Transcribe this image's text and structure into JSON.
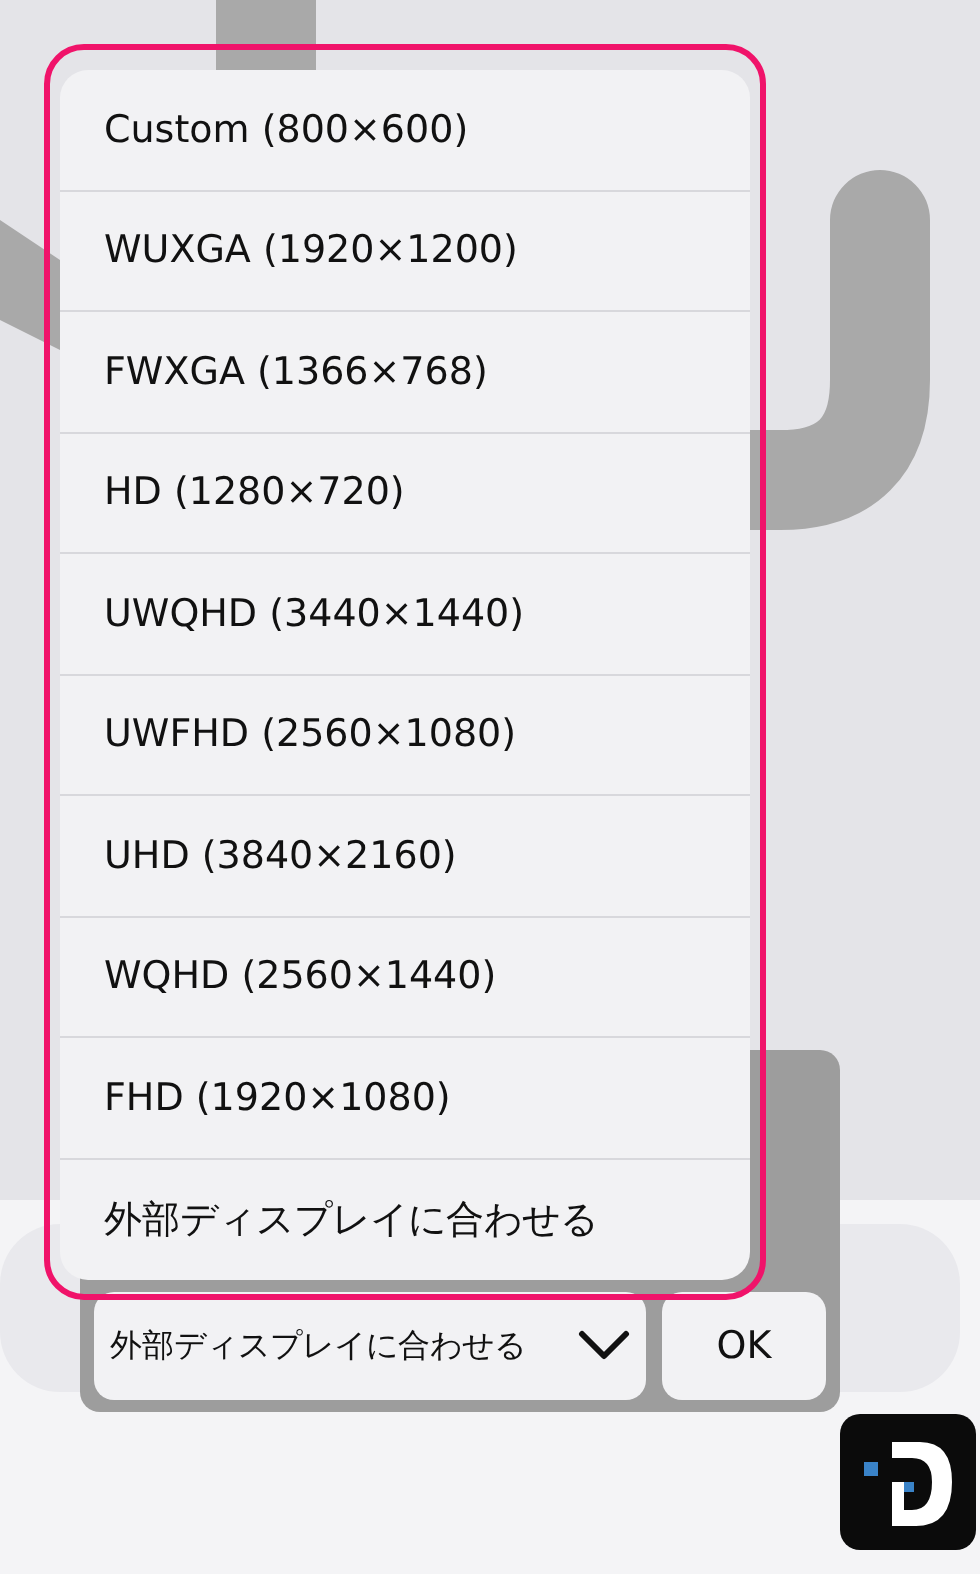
{
  "menu": {
    "items": [
      {
        "label": "Custom (800×600)"
      },
      {
        "label": "WUXGA (1920×1200)"
      },
      {
        "label": "FWXGA (1366×768)"
      },
      {
        "label": "HD (1280×720)"
      },
      {
        "label": "UWQHD (3440×1440)"
      },
      {
        "label": "UWFHD (2560×1080)"
      },
      {
        "label": "UHD (3840×2160)"
      },
      {
        "label": "WQHD (2560×1440)"
      },
      {
        "label": "FHD (1920×1080)"
      },
      {
        "label": "外部ディスプレイに合わせる"
      }
    ]
  },
  "dropdown": {
    "value": "外部ディスプレイに合わせる"
  },
  "buttons": [
    "OK"
  ]
}
